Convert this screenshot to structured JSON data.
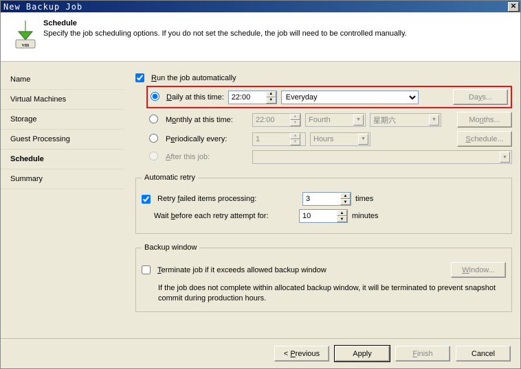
{
  "window": {
    "title": "New Backup Job"
  },
  "header": {
    "title": "Schedule",
    "subtitle": "Specify the job scheduling options. If you do not set the schedule, the job will need to be controlled manually."
  },
  "sidebar": {
    "items": [
      {
        "label": "Name"
      },
      {
        "label": "Virtual Machines"
      },
      {
        "label": "Storage"
      },
      {
        "label": "Guest Processing"
      },
      {
        "label": "Schedule"
      },
      {
        "label": "Summary"
      }
    ],
    "selected_index": 4
  },
  "schedule": {
    "run_auto_label": "Run the job automatically",
    "run_auto_checked": true,
    "daily_label": "Daily at this time:",
    "daily_time": "22:00",
    "daily_day": "Everyday",
    "daily_selected": true,
    "days_button": "Days...",
    "monthly_label": "Monthly at this time:",
    "monthly_time": "22:00",
    "monthly_week": "Fourth",
    "monthly_weekday": "星期六",
    "months_button": "Months...",
    "periodic_label": "Periodically every:",
    "periodic_value": "1",
    "periodic_unit": "Hours",
    "schedule_button": "Schedule...",
    "after_label": "After this job:",
    "after_job": ""
  },
  "retry": {
    "legend": "Automatic retry",
    "retry_label": "Retry failed items processing:",
    "retry_checked": true,
    "retry_count": "3",
    "retry_times": "times",
    "wait_label": "Wait before each retry attempt for:",
    "wait_value": "10",
    "wait_unit": "minutes"
  },
  "backup_window": {
    "legend": "Backup window",
    "terminate_label": "Terminate job if it exceeds allowed backup window",
    "terminate_checked": false,
    "window_button": "Window...",
    "hint": "If the job does not complete within allocated backup window, it will be terminated to prevent snapshot commit during production hours."
  },
  "footer": {
    "previous": "< Previous",
    "apply": "Apply",
    "finish": "Finish",
    "cancel": "Cancel"
  }
}
